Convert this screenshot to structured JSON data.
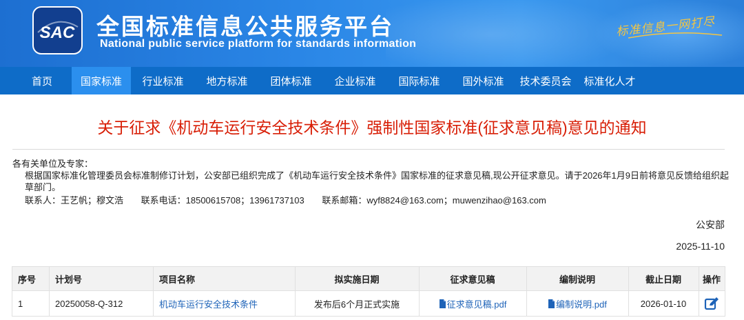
{
  "header": {
    "title_cn": "全国标准信息公共服务平台",
    "title_en": "National public service platform  for standards information",
    "logo_text": "SAC",
    "slogan": "标准信息一网打尽"
  },
  "nav": {
    "items": [
      "首页",
      "国家标准",
      "行业标准",
      "地方标准",
      "团体标准",
      "企业标准",
      "国际标准",
      "国外标准",
      "技术委员会",
      "标准化人才"
    ],
    "active_index": 1
  },
  "notice": {
    "title": "关于征求《机动车运行安全技术条件》强制性国家标准(征求意见稿)意见的通知",
    "salutation": "各有关单位及专家：",
    "paragraph": "根据国家标准化管理委员会标准制修订计划，公安部已组织完成了《机动车运行安全技术条件》国家标准的征求意见稿,现公开征求意见。请于2026年1月9日前将意见反馈给组织起草部门。",
    "contact_person": "联系人：王艺帆；穆文浩",
    "contact_phone": "联系电话：18500615708；13961737103",
    "contact_email": "联系邮箱：wyf8824@163.com；muwenzihao@163.com",
    "org": "公安部",
    "date": "2025-11-10"
  },
  "table": {
    "headers": {
      "seq": "序号",
      "plan": "计划号",
      "name": "项目名称",
      "impl": "拟实施日期",
      "draft": "征求意见稿",
      "explain": "编制说明",
      "deadline": "截止日期",
      "action": "操作"
    },
    "rows": [
      {
        "seq": "1",
        "plan": "20250058-Q-312",
        "name": "机动车运行安全技术条件",
        "impl": "发布后6个月正式实施",
        "draft": "征求意见稿.pdf",
        "explain": "编制说明.pdf",
        "deadline": "2026-01-10",
        "action_icon": "edit-icon"
      }
    ]
  },
  "colors": {
    "header_bg": "#2a86e6",
    "nav_bg": "#0e6cc8",
    "nav_active": "#2b8fee",
    "title_red": "#d81e06",
    "link_blue": "#1e63b8"
  }
}
